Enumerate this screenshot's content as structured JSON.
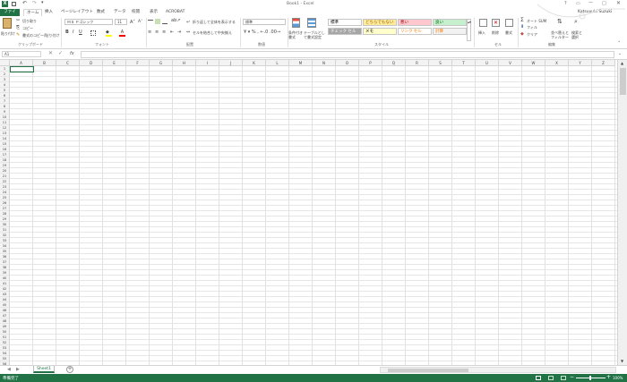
{
  "title": "Book1 - Excel",
  "user": "Katsuyuki Suzuki",
  "tabs": [
    "ファイル",
    "ホーム",
    "挿入",
    "ページレイアウト",
    "数式",
    "データ",
    "校閲",
    "表示",
    "ACROBAT"
  ],
  "clipboard": {
    "paste": "貼り付け",
    "cut": "切り取り",
    "copy": "コピー",
    "format_painter": "書式のコピー/貼り付け",
    "label": "クリップボード"
  },
  "font": {
    "name": "ＭＳ Ｐゴシック",
    "size": "11",
    "label": "フォント"
  },
  "alignment": {
    "wrap": "折り返して全体を表示する",
    "merge": "セルを結合して中央揃え",
    "label": "配置"
  },
  "number": {
    "format": "標準",
    "label": "数値"
  },
  "styles": {
    "conditional": "条件付き書式",
    "table": "テーブルとして書式設定",
    "label": "スタイル",
    "items": [
      {
        "label": "標準",
        "bg": "#ffffff",
        "fg": "#000000"
      },
      {
        "label": "どちらでもない",
        "bg": "#ffeb9c",
        "fg": "#9c6500"
      },
      {
        "label": "悪い",
        "bg": "#ffc7ce",
        "fg": "#9c0006"
      },
      {
        "label": "良い",
        "bg": "#c6efce",
        "fg": "#006100"
      },
      {
        "label": "チェック セル",
        "bg": "#a5a5a5",
        "fg": "#ffffff"
      },
      {
        "label": "メモ",
        "bg": "#ffffcc",
        "fg": "#000000"
      },
      {
        "label": "リンク セル",
        "bg": "#ffffff",
        "fg": "#fa7d00"
      },
      {
        "label": "計算",
        "bg": "#f2f2f2",
        "fg": "#fa7d00"
      }
    ]
  },
  "cells": {
    "insert": "挿入",
    "delete": "削除",
    "format": "書式",
    "label": "セル"
  },
  "editing": {
    "autosum": "オート SUM",
    "fill": "フィル",
    "clear": "クリア",
    "sort": "並べ替えとフィルター",
    "find": "検索と選択",
    "label": "編集"
  },
  "namebox": "A1",
  "fx": "fx",
  "columns": [
    "A",
    "B",
    "C",
    "D",
    "E",
    "F",
    "G",
    "H",
    "I",
    "J",
    "K",
    "L",
    "M",
    "N",
    "O",
    "P",
    "Q",
    "R",
    "S",
    "T",
    "U",
    "V",
    "W",
    "X",
    "Y",
    "Z"
  ],
  "sheet_tab": "Sheet1",
  "status": "準備完了",
  "zoom": "100%",
  "accent": "#217346"
}
